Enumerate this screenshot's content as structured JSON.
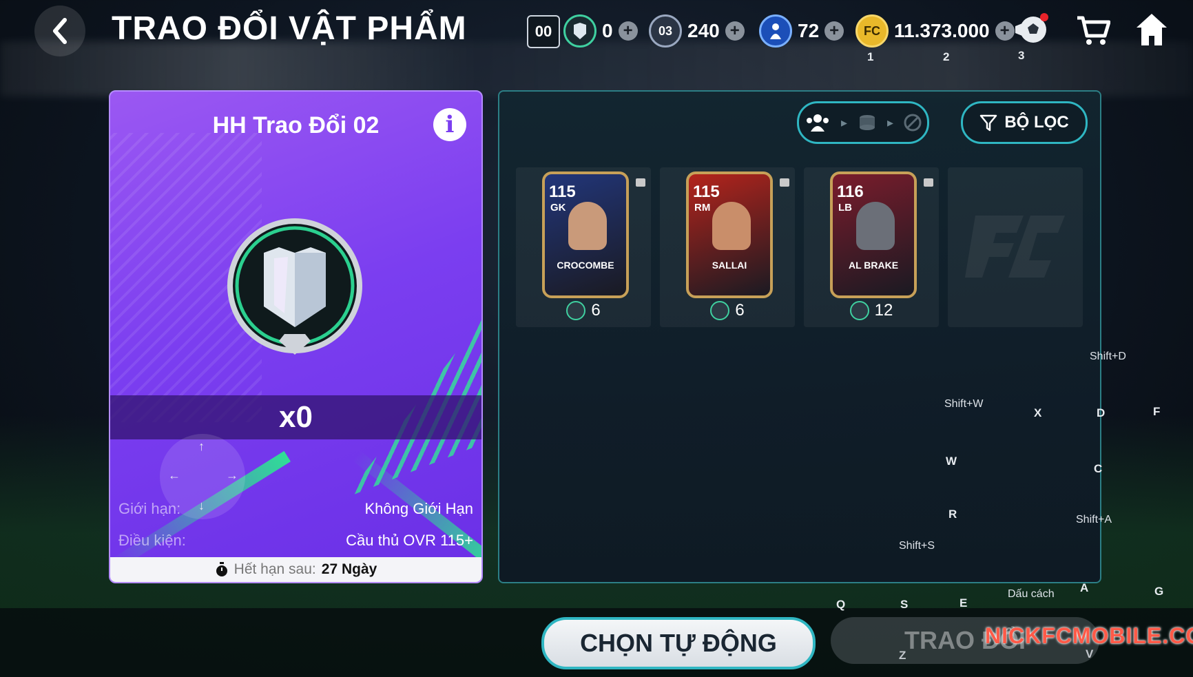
{
  "header": {
    "title": "TRAO ĐỔI VẬT PHẨM",
    "code_badge": "00",
    "currencies": [
      {
        "icon": "exchange-token-icon",
        "value": "0"
      },
      {
        "icon": "season-03-icon",
        "badge": "03",
        "value": "240"
      },
      {
        "icon": "player-icon",
        "value": "72"
      },
      {
        "icon": "fc-coin-icon",
        "value": "11.373.000"
      }
    ],
    "hotkeys": {
      "one": "1",
      "two": "2",
      "three": "3"
    }
  },
  "reward": {
    "title": "HH Trao Đổi 02",
    "quantity": "x0",
    "limit_label": "Giới hạn:",
    "limit_value": "Không Giới Hạn",
    "condition_label": "Điều kiện:",
    "condition_value": "Cầu thủ OVR 115+",
    "expire_label": "Hết hạn sau:",
    "expire_value": "27 Ngày",
    "dpad": {
      "up": "↑",
      "down": "↓",
      "left": "←",
      "right": "→"
    }
  },
  "inventory": {
    "filter_label": "BỘ LỌC",
    "players": [
      {
        "ovr": "115",
        "pos": "GK",
        "name": "CROCOMBE",
        "cost": "6",
        "card_color": "#22367a",
        "face_color": "#c99a7a"
      },
      {
        "ovr": "115",
        "pos": "RM",
        "name": "SALLAI",
        "cost": "6",
        "card_color": "#b4241c",
        "face_color": "#c98e6a"
      },
      {
        "ovr": "116",
        "pos": "LB",
        "name": "AL BRAKE",
        "cost": "12",
        "card_color": "#7a1c2c",
        "face_color": "#6b6f78"
      }
    ]
  },
  "hotkey_overlay": {
    "shift_d": "Shift+D",
    "shift_w": "Shift+W",
    "x": "X",
    "d": "D",
    "f": "F",
    "w": "W",
    "c": "C",
    "r": "R",
    "shift_a": "Shift+A",
    "shift_s": "Shift+S",
    "dau_cach": "Dấu cách",
    "a": "A",
    "g": "G",
    "q": "Q",
    "s": "S",
    "e": "E",
    "z": "Z",
    "v": "V"
  },
  "buttons": {
    "auto_select": "CHỌN TỰ ĐỘNG",
    "trade": "TRAO ĐỔI"
  },
  "watermark": "NICKFCMOBILE.COM",
  "colors": {
    "accent": "#2fb6c2",
    "reward_purple": "#7b3ef0",
    "green": "#3fd0a0",
    "gold": "#e9b82a"
  }
}
